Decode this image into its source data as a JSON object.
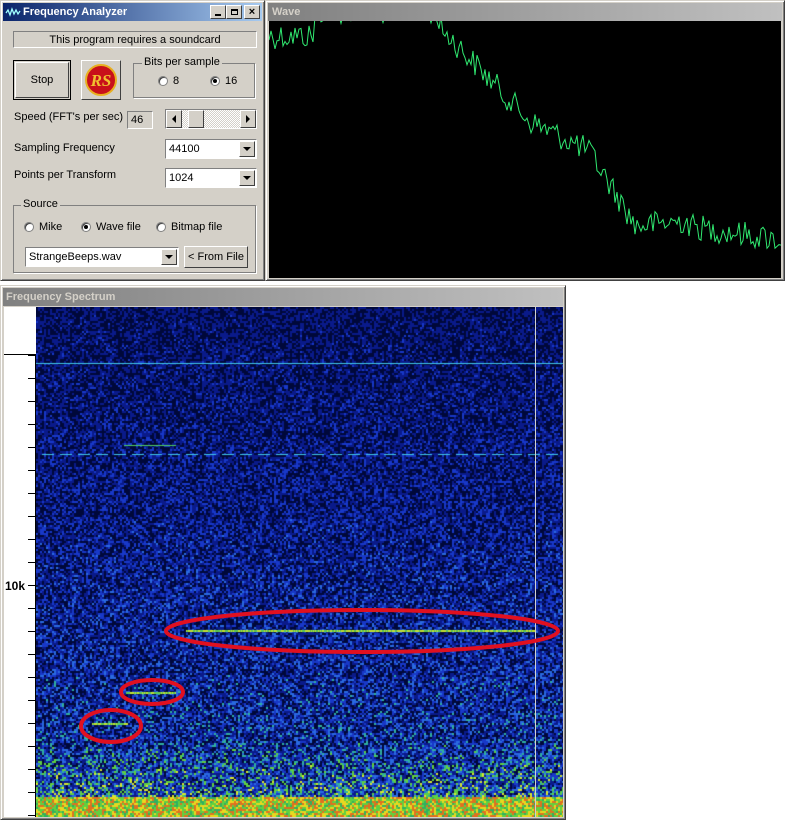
{
  "analyzer": {
    "title": "Frequency Analyzer",
    "notice": "This program requires a soundcard",
    "stop_label": "Stop",
    "logo_text": "RS",
    "bits": {
      "label": "Bits per sample",
      "opt8": "8",
      "opt16": "16",
      "selected": "16"
    },
    "speed": {
      "label": "Speed (FFT's per sec)",
      "value": "46",
      "slider_fraction": 0.15
    },
    "sampling": {
      "label": "Sampling Frequency",
      "value": "44100"
    },
    "points": {
      "label": "Points per Transform",
      "value": "1024"
    },
    "source": {
      "label": "Source",
      "mike": "Mike",
      "wave": "Wave file",
      "bitmap": "Bitmap file",
      "selected": "Wave file"
    },
    "file": {
      "value": "StrangeBeeps.wav",
      "from_file_label": "< From File"
    }
  },
  "wave": {
    "title": "Wave"
  },
  "spectrum": {
    "title": "Frequency Spectrum",
    "axis_label": "10k",
    "highlight_color": "#e01020"
  },
  "colors": {
    "title_active": "#0a246a",
    "title_inactive": "#808080",
    "face": "#d4d0c8"
  }
}
